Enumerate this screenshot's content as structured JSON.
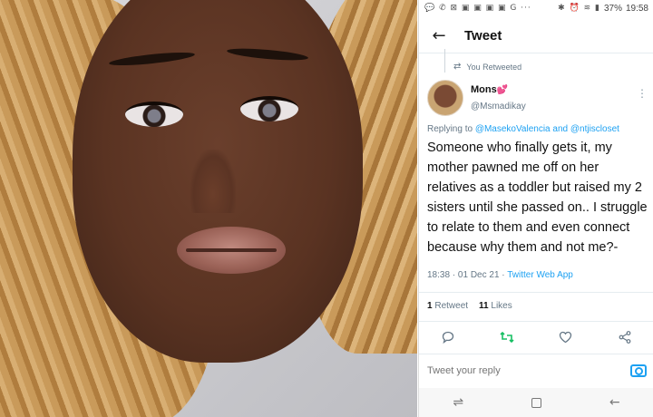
{
  "status_bar": {
    "left_icons": "💬 ✆ ⊠ ▣ ▣ ▣ ▣ G ···",
    "right_icons": "✱ ⏰ ≋ ▮",
    "battery": "37%",
    "time": "19:58"
  },
  "header": {
    "title": "Tweet"
  },
  "retweet": {
    "label": "You Retweeted"
  },
  "author": {
    "name": "Mons",
    "heart": "💕",
    "handle": "@Msmadikay"
  },
  "reply_to": {
    "prefix": "Replying to",
    "mention1": "@MasekoValencia",
    "joiner": "and",
    "mention2": "@ntjiscloset"
  },
  "tweet": {
    "text": "Someone who finally gets it, my mother pawned me off on her relatives as a toddler but raised my 2 sisters until she passed on.. I struggle to relate to them and even connect because why them and not me?-",
    "time": "18:38",
    "date": "01 Dec 21",
    "client": "Twitter Web App"
  },
  "stats": {
    "retweets_count": "1",
    "retweets_label": "Retweet",
    "likes_count": "11",
    "likes_label": "Likes"
  },
  "reply_bar": {
    "placeholder": "Tweet your reply"
  },
  "icons": {
    "back": "arrow-left-icon",
    "reply": "comment-icon",
    "retweet": "retweet-icon",
    "like": "heart-icon",
    "share": "share-icon",
    "camera": "camera-icon"
  },
  "colors": {
    "link": "#1da1f2",
    "retweet_active": "#17bf63",
    "secondary_text": "#657786"
  }
}
